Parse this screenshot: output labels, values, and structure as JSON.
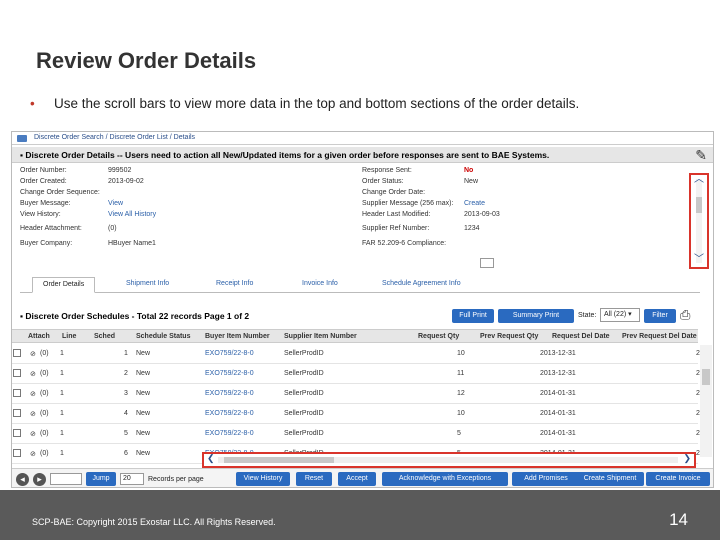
{
  "slide": {
    "title": "Review Order Details",
    "bullet": "•",
    "bullet_text": "Use the scroll bars to view more data in the top and bottom sections of the order details.",
    "footer": "SCP-BAE: Copyright 2015 Exostar LLC. All Rights Reserved.",
    "page_number": "14"
  },
  "app": {
    "breadcrumb": "Discrete Order Search / Discrete Order List / Details",
    "details_title": "Discrete Order Details -- Users need to action all New/Updated items for a given order before responses are sent to BAE Systems.",
    "left_fields": [
      {
        "label": "Order Number:",
        "value": "999502",
        "link": false
      },
      {
        "label": "Order Created:",
        "value": "2013-09-02",
        "link": false
      },
      {
        "label": "Change Order Sequence:",
        "value": "",
        "link": false
      },
      {
        "label": "Buyer Message:",
        "value": "View",
        "link": true
      },
      {
        "label": "View History:",
        "value": "View All History",
        "link": true
      },
      {
        "label": "Header Attachment:",
        "value": "(0)",
        "link": false
      },
      {
        "label": "Buyer Company:",
        "value": "HBuyer Name1",
        "link": false
      }
    ],
    "right_fields": [
      {
        "label": "Response Sent:",
        "value": "No",
        "style": "red"
      },
      {
        "label": "Order Status:",
        "value": "New",
        "style": "plain"
      },
      {
        "label": "Change Order Date:",
        "value": "",
        "style": "plain"
      },
      {
        "label": "Supplier Message (256 max):",
        "value": "Create",
        "style": "link"
      },
      {
        "label": "Header Last Modified:",
        "value": "2013-09-03",
        "style": "plain"
      },
      {
        "label": "Supplier Ref Number:",
        "value": "1234",
        "style": "plain"
      },
      {
        "label": "FAR 52.209-6 Compliance:",
        "value": "",
        "style": "plain"
      }
    ],
    "tabs": [
      "Order Details",
      "Shipment Info",
      "Receipt Info",
      "Invoice Info",
      "Schedule Agreement Info"
    ],
    "schedules_title": "Discrete Order Schedules - Total 22 records Page 1 of 2",
    "full_print": "Full Print",
    "summary_print": "Summary Print",
    "state_label": "State:",
    "state_value": "All (22)",
    "filter": "Filter",
    "columns": [
      "Attach",
      "Line",
      "Sched",
      "Schedule Status",
      "Buyer Item Number",
      "Supplier Item Number",
      "Request Qty",
      "Prev Request Qty",
      "Request Del Date",
      "Prev Request Del Date"
    ],
    "rows": [
      {
        "attach": "(0)",
        "line": "1",
        "sched": "1",
        "status": "New",
        "buyer_item": "EXO759/22-8-0",
        "supplier_item": "SellerProdID",
        "qty": "10",
        "prev_qty": "",
        "del_date": "2013-12-31",
        "prev_del": "2"
      },
      {
        "attach": "(0)",
        "line": "1",
        "sched": "2",
        "status": "New",
        "buyer_item": "EXO759/22-8-0",
        "supplier_item": "SellerProdID",
        "qty": "11",
        "prev_qty": "",
        "del_date": "2013-12-31",
        "prev_del": "2"
      },
      {
        "attach": "(0)",
        "line": "1",
        "sched": "3",
        "status": "New",
        "buyer_item": "EXO759/22-8-0",
        "supplier_item": "SellerProdID",
        "qty": "12",
        "prev_qty": "",
        "del_date": "2014-01-31",
        "prev_del": "2"
      },
      {
        "attach": "(0)",
        "line": "1",
        "sched": "4",
        "status": "New",
        "buyer_item": "EXO759/22-8-0",
        "supplier_item": "SellerProdID",
        "qty": "10",
        "prev_qty": "",
        "del_date": "2014-01-31",
        "prev_del": "2"
      },
      {
        "attach": "(0)",
        "line": "1",
        "sched": "5",
        "status": "New",
        "buyer_item": "EXO759/22-8-0",
        "supplier_item": "SellerProdID",
        "qty": "5",
        "prev_qty": "",
        "del_date": "2014-01-31",
        "prev_del": "2"
      },
      {
        "attach": "(0)",
        "line": "1",
        "sched": "6",
        "status": "New",
        "buyer_item": "EXO759/22-8-0",
        "supplier_item": "SellerProdID",
        "qty": "5",
        "prev_qty": "",
        "del_date": "2014-01-31",
        "prev_del": "2"
      }
    ],
    "jump": "Jump",
    "per_page_value": "20",
    "per_page_label": "Records per page",
    "actions": [
      "View History",
      "Reset",
      "Accept",
      "Acknowledge with Exceptions",
      "Add Promises",
      "Create Shipment",
      "Create Invoice"
    ],
    "colors": {
      "accent": "#2a6ac0",
      "highlight": "#d9342b",
      "link": "#2a5fa8"
    }
  }
}
